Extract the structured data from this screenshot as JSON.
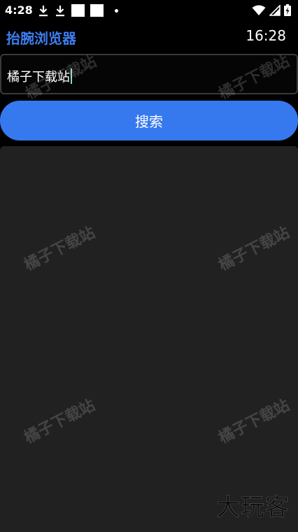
{
  "status_bar": {
    "time": "4:28",
    "icons": [
      "download-icon",
      "download-icon",
      "white-square-icon",
      "white-square-icon",
      "dot-icon",
      "wifi-icon",
      "signal-icon",
      "battery-charging-icon"
    ]
  },
  "header": {
    "title": "抬腕浏览器",
    "clock": "16:28"
  },
  "search": {
    "value": "橘子下载站"
  },
  "search_button": {
    "label": "搜索"
  },
  "watermark": {
    "text": "橘子下载站"
  },
  "logo": {
    "text": "大玩客"
  },
  "colors": {
    "accent": "#3679ef",
    "title": "#3d7ef0",
    "panel": "#212121",
    "background": "#000000"
  }
}
